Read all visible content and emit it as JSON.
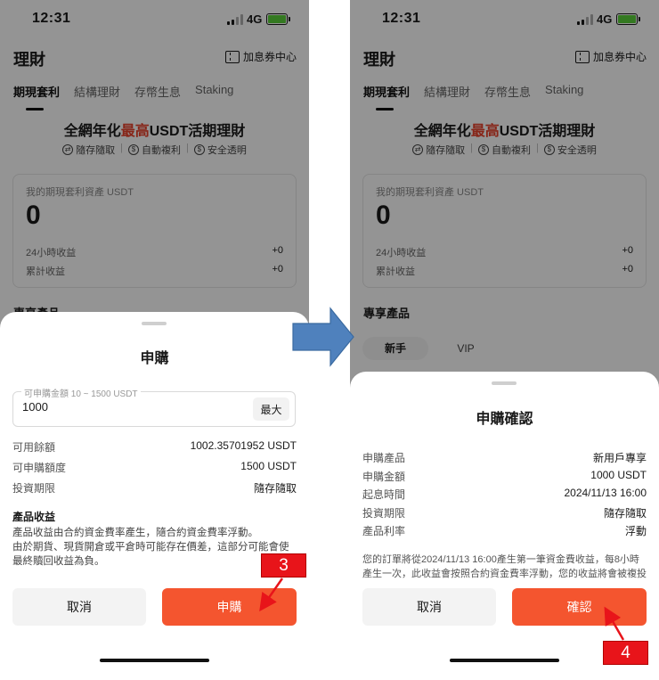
{
  "status_bar": {
    "time": "12:31",
    "network": "4G",
    "battery_color": "#5ad03a"
  },
  "header": {
    "title": "理財",
    "coupon_label": "加息券中心",
    "coupon_icon": "ticket-icon"
  },
  "tabs": [
    {
      "label": "期現套利",
      "active": true
    },
    {
      "label": "結構理財",
      "active": false
    },
    {
      "label": "存幣生息",
      "active": false
    },
    {
      "label": "Staking",
      "active": false
    }
  ],
  "promo": {
    "title_pre": "全網年化",
    "title_highlight": "最高",
    "title_post": "USDT活期理財",
    "highlight_color": "#e8402a",
    "features": [
      "隨存隨取",
      "自動複利",
      "安全透明"
    ]
  },
  "assets": {
    "label": "我的期現套利資產 USDT",
    "value": "0",
    "rows": [
      {
        "label": "24小時收益",
        "value": "+0"
      },
      {
        "label": "累計收益",
        "value": "+0"
      }
    ]
  },
  "exclusive": {
    "title": "專享產品",
    "left_title_partial": "專享產品",
    "pills": [
      "新手",
      "VIP"
    ]
  },
  "subscribe_sheet": {
    "title": "申購",
    "amount_legend": "可申購金額 10 ~ 1500 USDT",
    "amount_value": "1000",
    "max_label": "最大",
    "rows": [
      {
        "label": "可用餘額",
        "value": "1002.35701952 USDT"
      },
      {
        "label": "可申購額度",
        "value": "1500 USDT"
      },
      {
        "label": "投資期限",
        "value": "隨存隨取"
      }
    ],
    "income_title": "產品收益",
    "income_text_1": "產品收益由合約資金費率產生，隨合約資金費率浮動。",
    "income_text_2": "由於期貨、現貨開倉或平倉時可能存在價差，這部分可能會使最終贖回收益為負。",
    "cancel_label": "取消",
    "confirm_label": "申購"
  },
  "confirm_sheet": {
    "title": "申購確認",
    "rows": [
      {
        "label": "申購產品",
        "value": "新用戶專享"
      },
      {
        "label": "申購金額",
        "value": "1000 USDT"
      },
      {
        "label": "起息時間",
        "value": "2024/11/13 16:00"
      },
      {
        "label": "投資期限",
        "value": "隨存隨取"
      },
      {
        "label": "產品利率",
        "value": "浮動"
      }
    ],
    "notice": "您的訂單將從2024/11/13 16:00產生第一筆資金費收益，每8小時產生一次，此收益會按照合約資金費率浮動，您的收益將會被複投並計入本金。",
    "cancel_label": "取消",
    "confirm_label": "確認"
  },
  "annotations": {
    "step_left": "3",
    "step_right": "4",
    "annotation_color": "#e8141a",
    "flow_arrow_color": "#4f81bd"
  }
}
